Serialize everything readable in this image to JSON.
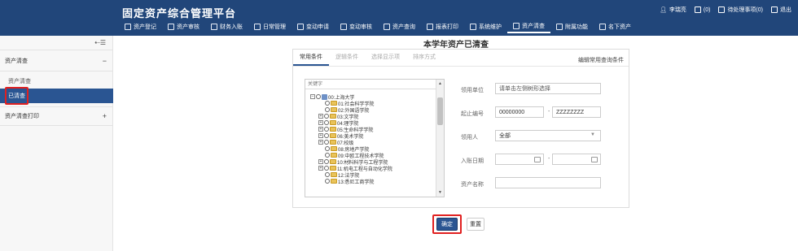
{
  "app": {
    "title": "固定资产综合管理平台"
  },
  "top_right": {
    "user": "李瑞亮",
    "messages": "(0)",
    "todo": "待处理事项(0)",
    "logout": "退出"
  },
  "nav": {
    "items": [
      {
        "label": "资产登记",
        "icon": "register-icon"
      },
      {
        "label": "资产审核",
        "icon": "user-check-icon"
      },
      {
        "label": "财务入账",
        "icon": "ledger-icon"
      },
      {
        "label": "日常管理",
        "icon": "grid-icon"
      },
      {
        "label": "变动申请",
        "icon": "change-apply-icon"
      },
      {
        "label": "变动审核",
        "icon": "change-review-icon"
      },
      {
        "label": "资产查询",
        "icon": "query-icon"
      },
      {
        "label": "报表打印",
        "icon": "print-icon"
      },
      {
        "label": "系统维护",
        "icon": "gear-icon"
      },
      {
        "label": "资产清查",
        "icon": "home-icon",
        "active": true
      },
      {
        "label": "附属功能",
        "icon": "list-icon"
      },
      {
        "label": "名下资产",
        "icon": "bar-chart-icon"
      }
    ]
  },
  "sidebar": {
    "toggle": "⇠☰",
    "group1": {
      "label": "资产清查",
      "sign": "−"
    },
    "sub1": "资产清查",
    "sub2": "已清查",
    "group2": {
      "label": "资产清查打印",
      "sign": "+"
    }
  },
  "main": {
    "title": "本学年资产已清查",
    "tabs": [
      "常用条件",
      "逻辑条件",
      "选择显示项",
      "排序方式"
    ],
    "common_conditions_link": "编辑常用查询条件",
    "keyword_placeholder": "关键字",
    "tree": [
      {
        "label": "00:上海大学",
        "level": 0,
        "expander": "⊟",
        "root": true
      },
      {
        "label": "01:社会科学学院",
        "level": 1,
        "expander": ""
      },
      {
        "label": "02:外国语学院",
        "level": 1,
        "expander": ""
      },
      {
        "label": "03:文学院",
        "level": 1,
        "expander": "⊞"
      },
      {
        "label": "04:理学院",
        "level": 1,
        "expander": "⊞"
      },
      {
        "label": "05:生命科学学院",
        "level": 1,
        "expander": "⊞"
      },
      {
        "label": "06:美术学院",
        "level": 1,
        "expander": "⊞"
      },
      {
        "label": "07:校级",
        "level": 1,
        "expander": "⊞"
      },
      {
        "label": "08:房地产学院",
        "level": 1,
        "expander": ""
      },
      {
        "label": "09:中欧工程技术学院",
        "level": 1,
        "expander": ""
      },
      {
        "label": "10:材料科学与工程学院",
        "level": 1,
        "expander": "⊞"
      },
      {
        "label": "11:机电工程与自动化学院",
        "level": 1,
        "expander": "⊞"
      },
      {
        "label": "12:法学院",
        "level": 1,
        "expander": ""
      },
      {
        "label": "13:悉尼工商学院",
        "level": 1,
        "expander": ""
      }
    ],
    "form": {
      "unit_label": "领用单位",
      "unit_placeholder": "请单击左侧树形选择",
      "start_no_label": "起止编号",
      "start_no_from": "00000000",
      "start_no_to": "ZZZZZZZZ",
      "user_label": "领用人",
      "user_value": "全部",
      "date_label": "入账日期",
      "name_label": "资产名称"
    },
    "buttons": {
      "confirm": "确定",
      "reset": "重置"
    }
  }
}
